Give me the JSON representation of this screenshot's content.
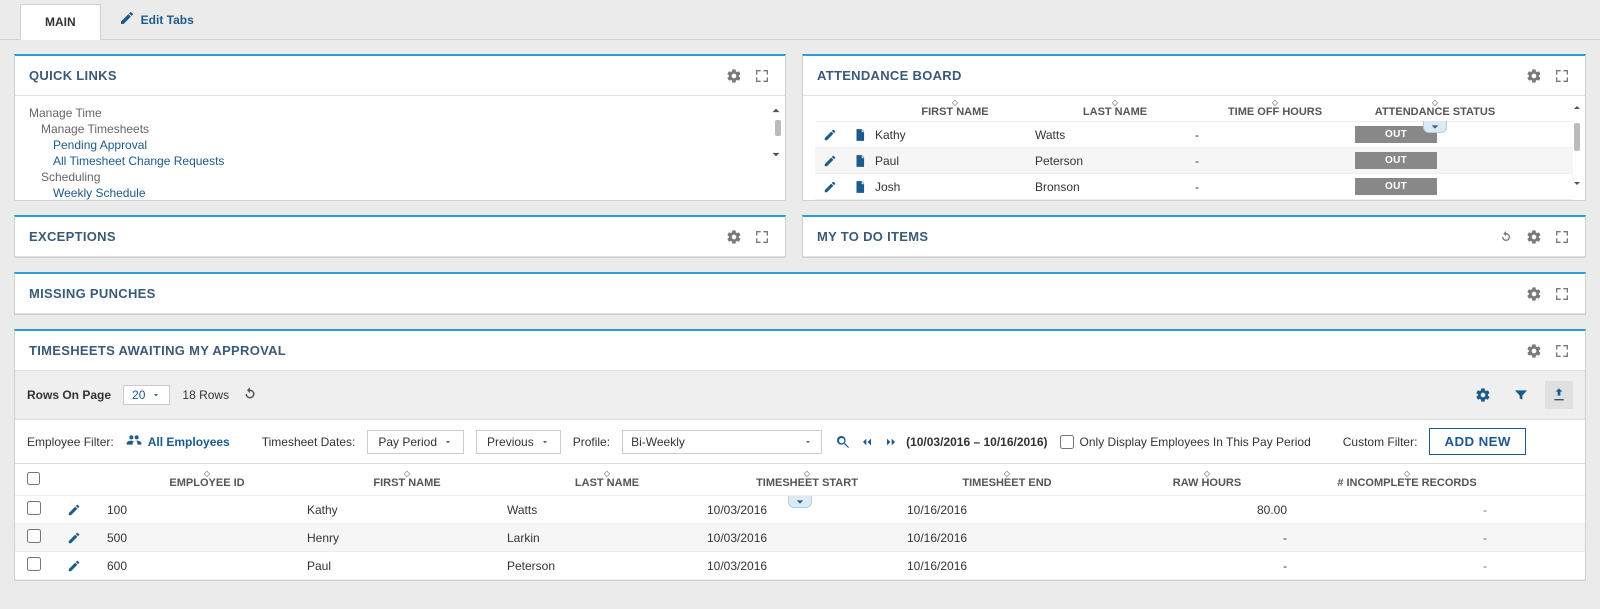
{
  "tabs": {
    "main": "MAIN",
    "edit": "Edit Tabs"
  },
  "quick_links": {
    "title": "QUICK LINKS",
    "heading1": "Manage Time",
    "sub1": "Manage Timesheets",
    "link_pending": "Pending Approval",
    "link_allchanges": "All Timesheet Change Requests",
    "heading2": "Scheduling",
    "link_weekly": "Weekly Schedule"
  },
  "attendance": {
    "title": "ATTENDANCE BOARD",
    "cols": {
      "first": "FIRST NAME",
      "last": "LAST NAME",
      "timeoff": "TIME OFF HOURS",
      "status": "ATTENDANCE STATUS"
    },
    "rows": [
      {
        "first": "Kathy",
        "last": "Watts",
        "timeoff": "-",
        "status": "OUT"
      },
      {
        "first": "Paul",
        "last": "Peterson",
        "timeoff": "-",
        "status": "OUT"
      },
      {
        "first": "Josh",
        "last": "Bronson",
        "timeoff": "-",
        "status": "OUT"
      }
    ]
  },
  "exceptions": {
    "title": "EXCEPTIONS"
  },
  "todo": {
    "title": "MY TO DO ITEMS"
  },
  "missing": {
    "title": "MISSING PUNCHES"
  },
  "timesheets": {
    "title": "TIMESHEETS AWAITING MY APPROVAL",
    "rows_on_page_label": "Rows On Page",
    "rows_on_page_value": "20",
    "row_count": "18 Rows",
    "emp_filter_label": "Employee Filter:",
    "emp_filter_value": "All Employees",
    "ts_dates_label": "Timesheet Dates:",
    "period_sel": "Pay Period",
    "prev_sel": "Previous",
    "profile_label": "Profile:",
    "profile_value": "Bi-Weekly",
    "date_range": "(10/03/2016 – 10/16/2016)",
    "only_display_label": "Only Display Employees In This Pay Period",
    "custom_filter_label": "Custom Filter:",
    "add_new": "ADD NEW",
    "cols": {
      "empid": "EMPLOYEE ID",
      "first": "FIRST NAME",
      "last": "LAST NAME",
      "start": "TIMESHEET START",
      "end": "TIMESHEET END",
      "raw": "RAW HOURS",
      "incomplete": "# INCOMPLETE RECORDS"
    },
    "rows": [
      {
        "empid": "100",
        "first": "Kathy",
        "last": "Watts",
        "start": "10/03/2016",
        "end": "10/16/2016",
        "raw": "80.00",
        "inc": "-"
      },
      {
        "empid": "500",
        "first": "Henry",
        "last": "Larkin",
        "start": "10/03/2016",
        "end": "10/16/2016",
        "raw": "-",
        "inc": "-"
      },
      {
        "empid": "600",
        "first": "Paul",
        "last": "Peterson",
        "start": "10/03/2016",
        "end": "10/16/2016",
        "raw": "-",
        "inc": "-"
      }
    ]
  }
}
